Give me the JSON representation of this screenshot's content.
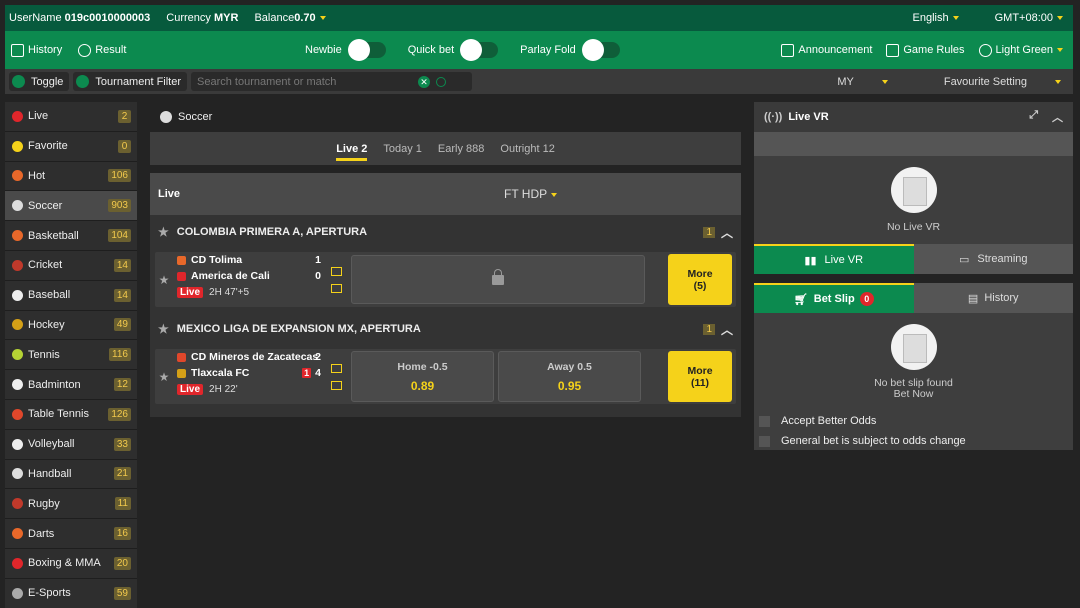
{
  "topbar": {
    "username_label": "UserName",
    "username": "019c0010000003",
    "currency_label": "Currency",
    "currency": "MYR",
    "balance_label": "Balance",
    "balance": "0.70",
    "language": "English",
    "timezone": "GMT+08:00"
  },
  "nav": {
    "history": "History",
    "result": "Result",
    "newbie": "Newbie",
    "quick_bet": "Quick bet",
    "parlay_fold": "Parlay Fold",
    "announcement": "Announcement",
    "game_rules": "Game Rules",
    "theme": "Light Green"
  },
  "filter": {
    "toggle": "Toggle",
    "tournament_filter": "Tournament Filter",
    "search_placeholder": "Search tournament or match",
    "odds_format": "MY",
    "favourite_setting": "Favourite Setting"
  },
  "sidebar": {
    "items": [
      {
        "label": "Live",
        "count": "2",
        "color": "#e0262b"
      },
      {
        "label": "Favorite",
        "count": "0",
        "color": "#f5d21a"
      },
      {
        "label": "Hot",
        "count": "106",
        "color": "#e8682a"
      },
      {
        "label": "Soccer",
        "count": "903",
        "color": "#dddddd"
      },
      {
        "label": "Basketball",
        "count": "104",
        "color": "#e8682a"
      },
      {
        "label": "Cricket",
        "count": "14",
        "color": "#c0392b"
      },
      {
        "label": "Baseball",
        "count": "14",
        "color": "#eeeeee"
      },
      {
        "label": "Hockey",
        "count": "49",
        "color": "#d4a017"
      },
      {
        "label": "Tennis",
        "count": "116",
        "color": "#b5d334"
      },
      {
        "label": "Badminton",
        "count": "12",
        "color": "#eeeeee"
      },
      {
        "label": "Table Tennis",
        "count": "126",
        "color": "#e0472b"
      },
      {
        "label": "Volleyball",
        "count": "33",
        "color": "#eeeeee"
      },
      {
        "label": "Handball",
        "count": "21",
        "color": "#dddddd"
      },
      {
        "label": "Rugby",
        "count": "11",
        "color": "#c0392b"
      },
      {
        "label": "Darts",
        "count": "16",
        "color": "#e8682a"
      },
      {
        "label": "Boxing & MMA",
        "count": "20",
        "color": "#e0262b"
      },
      {
        "label": "E-Sports",
        "count": "59",
        "color": "#aaaaaa"
      }
    ]
  },
  "main": {
    "breadcrumb": "Soccer",
    "tabs": [
      "Live 2",
      "Today 1",
      "Early 888",
      "Outright 12"
    ],
    "live_header": "Live",
    "market": "FT HDP",
    "leagues": [
      {
        "name": "COLOMBIA PRIMERA A, APERTURA",
        "count": "1",
        "match": {
          "home": "CD Tolima",
          "away": "America de Cali",
          "home_score": "1",
          "away_score": "0",
          "live": "Live",
          "time": "2H 47'+5",
          "more": "More",
          "more_count": "(5)"
        }
      },
      {
        "name": "MEXICO LIGA DE EXPANSION MX, APERTURA",
        "count": "1",
        "match": {
          "home": "CD Mineros de Zacatecas",
          "away": "Tlaxcala FC",
          "home_score": "2",
          "away_score": "4",
          "red_card": "1",
          "live": "Live",
          "time": "2H 22'",
          "home_odd_label": "Home -0.5",
          "home_odd": "0.89",
          "away_odd_label": "Away 0.5",
          "away_odd": "0.95",
          "more": "More",
          "more_count": "(11)"
        }
      }
    ]
  },
  "live_vr": {
    "title": "Live VR",
    "empty": "No Live VR",
    "tab_live_vr": "Live VR",
    "tab_streaming": "Streaming"
  },
  "bet_slip": {
    "tab": "Bet Slip",
    "count": "0",
    "history": "History",
    "empty_line1": "No bet slip found",
    "empty_line2": "Bet Now",
    "accept_better_odds": "Accept Better Odds",
    "odds_change_note": "General bet is subject to odds change"
  },
  "colors": {
    "brand_green": "#0c8a4f",
    "dark_green": "#075a3d",
    "accent_yellow": "#f5d21a",
    "live_red": "#e0262b"
  }
}
